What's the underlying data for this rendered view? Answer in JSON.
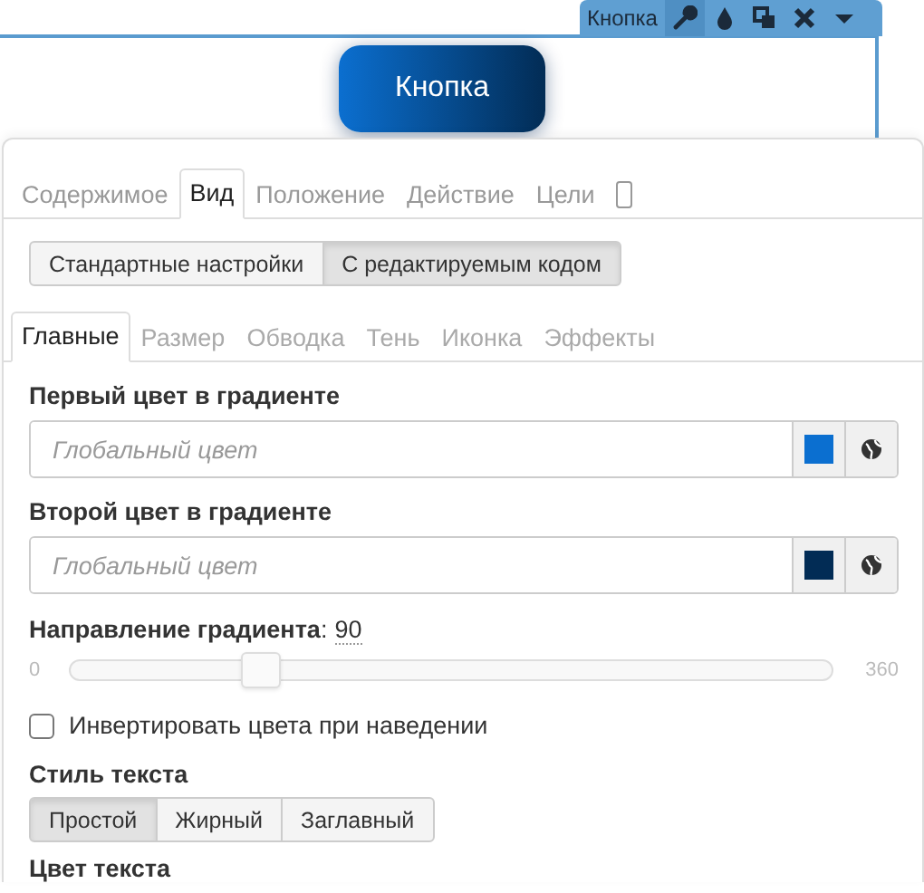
{
  "element_toolbar": {
    "label": "Кнопка",
    "tools": [
      {
        "kind": "wrench",
        "selected": true
      },
      {
        "kind": "drop",
        "selected": false
      },
      {
        "kind": "copy",
        "selected": false
      },
      {
        "kind": "close",
        "selected": false
      },
      {
        "kind": "caret",
        "selected": false
      }
    ]
  },
  "preview_button": {
    "label": "Кнопка"
  },
  "tabs": [
    {
      "label": "Содержимое",
      "selected": false
    },
    {
      "label": "Вид",
      "selected": true
    },
    {
      "label": "Положение",
      "selected": false
    },
    {
      "label": "Действие",
      "selected": false
    },
    {
      "label": "Цели",
      "selected": false
    },
    {
      "kind": "device",
      "selected": false
    }
  ],
  "mode_buttons": [
    {
      "label": "Стандартные настройки",
      "selected": false
    },
    {
      "label": "С редактируемым кодом",
      "selected": true
    }
  ],
  "subtabs": [
    {
      "label": "Главные",
      "selected": true
    },
    {
      "label": "Размер",
      "selected": false
    },
    {
      "label": "Обводка",
      "selected": false
    },
    {
      "label": "Тень",
      "selected": false
    },
    {
      "label": "Иконка",
      "selected": false
    },
    {
      "label": "Эффекты",
      "selected": false
    }
  ],
  "settings": [
    {
      "kind": "color",
      "label": "Первый цвет в градиенте",
      "placeholder": "Глобальный цвет",
      "color": "#0b6fd0"
    },
    {
      "kind": "color",
      "label": "Второй цвет в градиенте",
      "placeholder": "Глобальный цвет",
      "color": "#022c55"
    },
    {
      "kind": "slider",
      "label": "Направление градиента",
      "separator": ":",
      "value": "90",
      "min": "0",
      "max": "360",
      "level": 0.25
    },
    {
      "kind": "checkbox",
      "label": "Инвертировать цвета при наведении",
      "checked": false
    },
    {
      "kind": "segmented",
      "label": "Стиль текста",
      "options": [
        {
          "label": "Простой",
          "selected": true
        },
        {
          "label": "Жирный",
          "selected": false
        },
        {
          "label": "Заглавный",
          "selected": false
        }
      ]
    },
    {
      "kind": "heading",
      "label": "Цвет текста"
    }
  ]
}
